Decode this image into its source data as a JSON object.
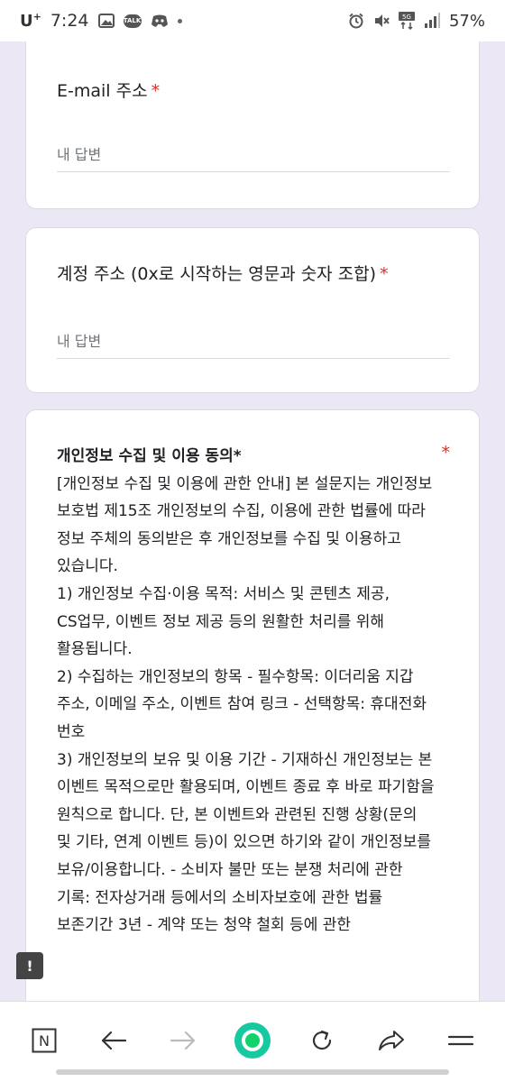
{
  "status_bar": {
    "carrier": "U",
    "carrier_sup": "+",
    "time": "7:24",
    "talk_badge": "TALK",
    "network": "5G",
    "battery": "57%"
  },
  "form": {
    "email_question": {
      "title": "E-mail 주소",
      "required_mark": "*",
      "placeholder": "내 답변"
    },
    "account_question": {
      "title": "계정 주소 (0x로 시작하는 영문과 숫자 조합)",
      "required_mark": "*",
      "placeholder": "내 답변"
    },
    "consent_question": {
      "title": "개인정보 수집 및 이용 동의*",
      "required_mark": "*",
      "body": "[개인정보 수집 및 이용에 관한 안내]  본 설문지는 개인정보 보호법 제15조 개인정보의 수집, 이용에 관한 법률에 따라 정보 주체의 동의받은 후 개인정보를 수집 및 이용하고 있습니다.\n1) 개인정보 수집·이용 목적: 서비스 및 콘텐츠 제공,  CS업무, 이벤트 정보 제공 등의 원활한 처리를 위해 활용됩니다.\n2) 수집하는 개인정보의 항목 - 필수항목: 이더리움 지갑 주소, 이메일 주소, 이벤트 참여 링크 - 선택항목: 휴대전화 번호\n3) 개인정보의 보유 및 이용 기간 - 기재하신 개인정보는 본 이벤트 목적으로만 활용되며, 이벤트 종료 후 바로 파기함을 원칙으로 합니다. 단, 본 이벤트와 관련된 진행 상황(문의 및 기타, 연계 이벤트 등)이 있으면 하기와 같이 개인정보를 보유/이용합니다. - 소비자 불만 또는 분쟁 처리에 관한 기록: 전자상거래 등에서의 소비자보호에 관한 법률 보존기간 3년 - 계약 또는 청약 철회 등에 관한"
    }
  },
  "feedback": {
    "label": "!"
  },
  "bottom_nav": {
    "n_label": "N"
  }
}
